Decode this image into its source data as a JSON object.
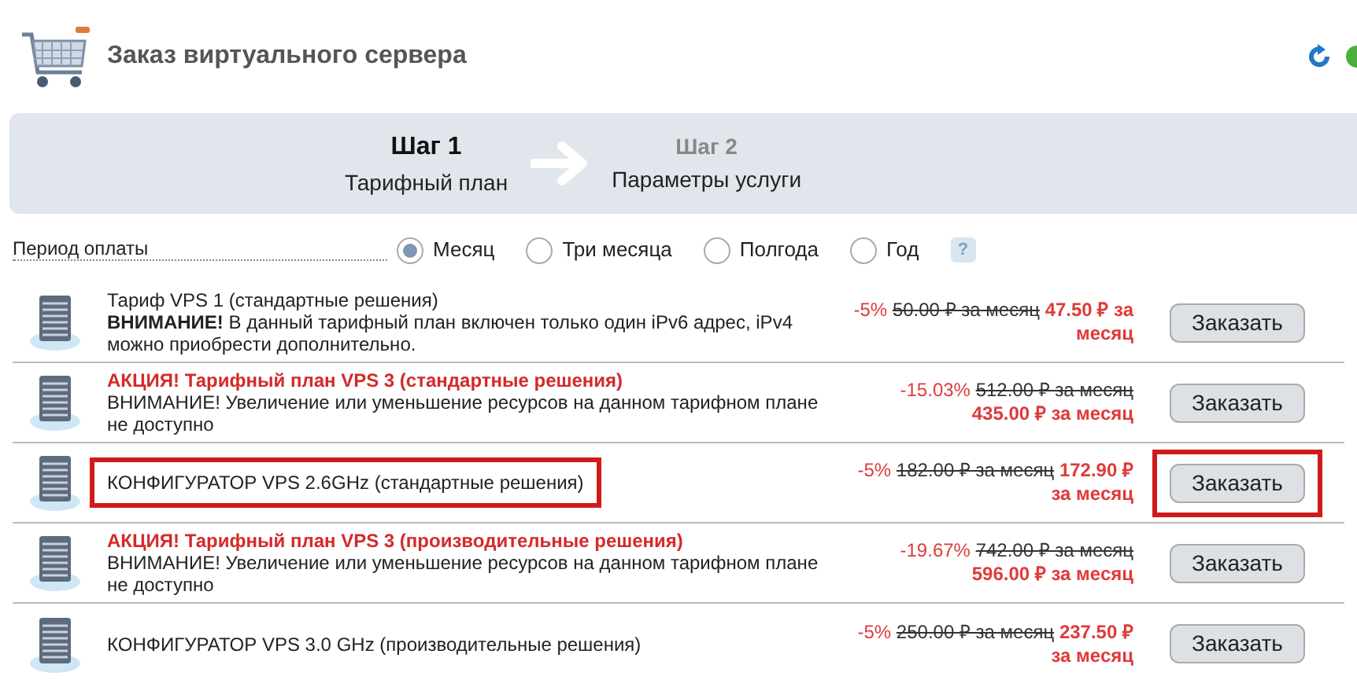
{
  "header": {
    "title": "Заказ виртуального сервера"
  },
  "steps": [
    {
      "number": "Шаг 1",
      "label": "Тарифный план",
      "selected": true
    },
    {
      "number": "Шаг 2",
      "label": "Параметры услуги",
      "selected": false
    }
  ],
  "period": {
    "label": "Период оплаты",
    "help": "?",
    "options": [
      {
        "label": "Месяц",
        "selected": true
      },
      {
        "label": "Три месяца",
        "selected": false
      },
      {
        "label": "Полгода",
        "selected": false
      },
      {
        "label": "Год",
        "selected": false
      }
    ]
  },
  "plans": [
    {
      "title": "Тариф VPS 1 (стандартные решения)",
      "kind": "regular",
      "note": "**ВНИМАНИЕ!** В данный тарифный план включен только один iPv6 адрес, iPv4 можно приобрести дополнительно.",
      "discount": "-5%",
      "old_price": "50.00 ₽ за месяц",
      "new_price": "47.50 ₽ за месяц",
      "button": "Заказать",
      "title_highlighted": false,
      "button_highlighted": false
    },
    {
      "title": "АКЦИЯ! Тарифный план VPS 3 (стандартные решения)",
      "kind": "promo",
      "note": "ВНИМАНИЕ! Увеличение или уменьшение ресурсов на данном тарифном плане не доступно",
      "discount": "-15.03%",
      "old_price": "512.00 ₽ за месяц",
      "new_price": "435.00 ₽ за месяц",
      "button": "Заказать",
      "title_highlighted": false,
      "button_highlighted": false
    },
    {
      "title": "КОНФИГУРАТОР VPS 2.6GHz (стандартные решения)",
      "kind": "regular",
      "discount": "-5%",
      "old_price": "182.00 ₽ за месяц",
      "new_price": "172.90 ₽ за месяц",
      "button": "Заказать",
      "title_highlighted": true,
      "button_highlighted": true
    },
    {
      "title": "АКЦИЯ! Тарифный план VPS 3 (производительные решения)",
      "kind": "promo",
      "note": "ВНИМАНИЕ! Увеличение или уменьшение ресурсов на данном тарифном плане не доступно",
      "discount": "-19.67%",
      "old_price": "742.00 ₽ за месяц",
      "new_price": "596.00 ₽ за месяц",
      "button": "Заказать",
      "title_highlighted": false,
      "button_highlighted": false
    },
    {
      "title": "КОНФИГУРАТОР VPS 3.0 GHz (производительные решения)",
      "kind": "regular",
      "discount": "-5%",
      "old_price": "250.00 ₽ за месяц",
      "new_price": "237.50 ₽ за месяц",
      "button": "Заказать",
      "title_highlighted": false,
      "button_highlighted": false
    }
  ]
}
